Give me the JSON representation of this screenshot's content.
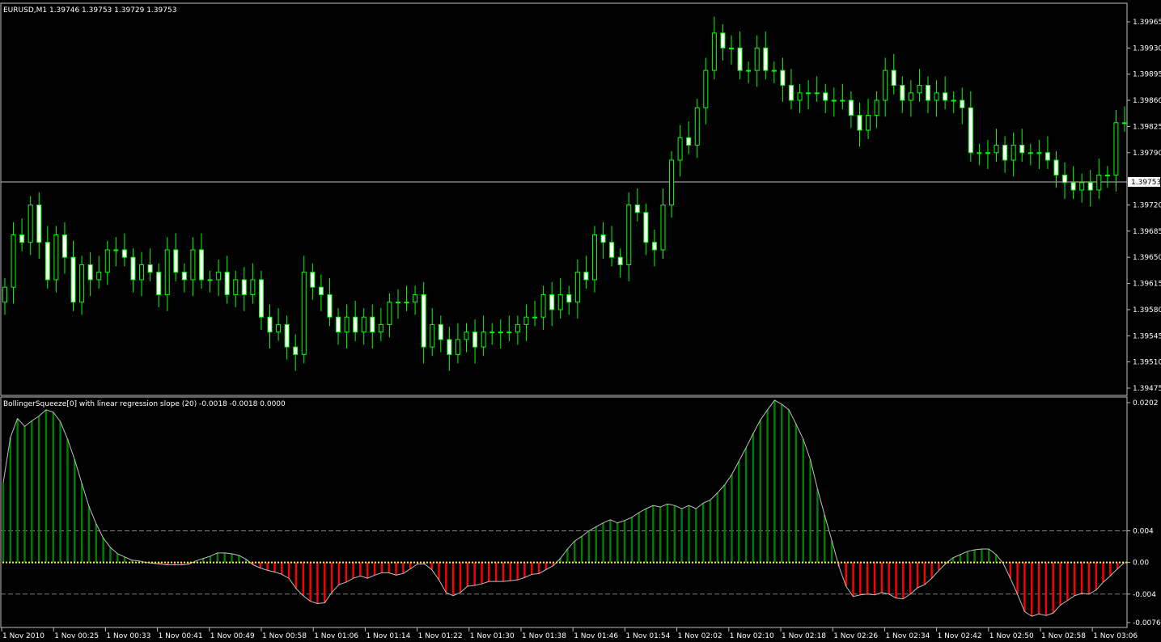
{
  "main_chart": {
    "header": "EURUSD,M1  1.39746 1.39753 1.39729 1.39753",
    "symbol": "EURUSD",
    "timeframe": "M1",
    "price_labels": [
      "1.39965",
      "1.39930",
      "1.39895",
      "1.39860",
      "1.39825",
      "1.39790",
      "1.39720",
      "1.39685",
      "1.39650",
      "1.39615",
      "1.39580",
      "1.39545",
      "1.39510",
      "1.39475"
    ],
    "current_price_label": "1.39753"
  },
  "indicator": {
    "header": "BollingerSqueeze[0] with linear regression slope (20) -0.0018 -0.0018 0.0000",
    "scale_labels": [
      "0.0202",
      "0.004",
      "0.00",
      "-0.004",
      "-0.0076"
    ]
  },
  "time_axis": {
    "labels": [
      "1 Nov 2010",
      "1 Nov 00:25",
      "1 Nov 00:33",
      "1 Nov 00:41",
      "1 Nov 00:49",
      "1 Nov 00:58",
      "1 Nov 01:06",
      "1 Nov 01:14",
      "1 Nov 01:22",
      "1 Nov 01:30",
      "1 Nov 01:38",
      "1 Nov 01:46",
      "1 Nov 01:54",
      "1 Nov 02:02",
      "1 Nov 02:10",
      "1 Nov 02:18",
      "1 Nov 02:26",
      "1 Nov 02:34",
      "1 Nov 02:42",
      "1 Nov 02:50",
      "1 Nov 02:58",
      "1 Nov 03:06"
    ]
  },
  "colors": {
    "background": "#000000",
    "border": "#c0c0c0",
    "candle": "#00ff00",
    "bull_fill": "#000000",
    "bear_fill": "#ffffff",
    "hist_positive": "#008000",
    "hist_negative": "#ff0000",
    "zero_dots": "#ffff00",
    "slope_line": "#c0c0c0",
    "level_lines": "#808080"
  },
  "chart_data": [
    {
      "type": "candlestick",
      "title": "EURUSD,M1",
      "ylim": [
        1.3947,
        1.3998
      ],
      "last_price": 1.39753,
      "closes": [
        1.3961,
        1.3968,
        1.3967,
        1.3972,
        1.3967,
        1.3962,
        1.3968,
        1.3965,
        1.3959,
        1.3964,
        1.3962,
        1.3963,
        1.3966,
        1.3966,
        1.3965,
        1.3962,
        1.3964,
        1.3963,
        1.396,
        1.3966,
        1.3963,
        1.3962,
        1.3966,
        1.3962,
        1.3962,
        1.3963,
        1.396,
        1.3962,
        1.396,
        1.3962,
        1.3957,
        1.3955,
        1.3956,
        1.3953,
        1.3952,
        1.3963,
        1.3961,
        1.396,
        1.3957,
        1.3955,
        1.3957,
        1.3955,
        1.3957,
        1.3955,
        1.3956,
        1.3959,
        1.3959,
        1.3959,
        1.396,
        1.3953,
        1.3956,
        1.3954,
        1.3952,
        1.3954,
        1.3955,
        1.3953,
        1.3955,
        1.3955,
        1.3955,
        1.3955,
        1.3956,
        1.3957,
        1.3957,
        1.396,
        1.3958,
        1.396,
        1.3959,
        1.3963,
        1.3962,
        1.3968,
        1.3967,
        1.3965,
        1.3964,
        1.3972,
        1.3971,
        1.3967,
        1.3966,
        1.3972,
        1.3978,
        1.3981,
        1.398,
        1.3985,
        1.399,
        1.3995,
        1.3993,
        1.3993,
        1.399,
        1.399,
        1.3993,
        1.399,
        1.399,
        1.3988,
        1.3986,
        1.3987,
        1.3987,
        1.3987,
        1.3986,
        1.3986,
        1.3986,
        1.3984,
        1.3982,
        1.3984,
        1.3986,
        1.399,
        1.3988,
        1.3986,
        1.3987,
        1.3988,
        1.3986,
        1.3987,
        1.3986,
        1.3986,
        1.3985,
        1.3979,
        1.3979,
        1.3979,
        1.398,
        1.3978,
        1.398,
        1.3979,
        1.3979,
        1.3979,
        1.3978,
        1.3976,
        1.3975,
        1.3974,
        1.3975,
        1.3974,
        1.3976,
        1.3976,
        1.3983,
        1.3983
      ]
    },
    {
      "type": "bar",
      "title": "BollingerSqueeze[0] with linear regression slope (20)",
      "ylim": [
        -0.0076,
        0.0202
      ],
      "levels": [
        0.004,
        -0.004
      ],
      "values": [
        0.0101,
        0.0158,
        0.0182,
        0.0172,
        0.0179,
        0.0185,
        0.0193,
        0.019,
        0.0178,
        0.0156,
        0.013,
        0.01,
        0.0071,
        0.0049,
        0.0031,
        0.0019,
        0.0011,
        0.0007,
        0.0003,
        0.0002,
        0.0,
        -0.0001,
        -0.0002,
        -0.0003,
        -0.0003,
        -0.0003,
        -0.0002,
        0.0002,
        0.0005,
        0.0008,
        0.0012,
        0.0012,
        0.0011,
        0.0009,
        0.0004,
        -0.0003,
        -0.0007,
        -0.001,
        -0.0012,
        -0.0015,
        -0.002,
        -0.0033,
        -0.0042,
        -0.0049,
        -0.0052,
        -0.0051,
        -0.0038,
        -0.0028,
        -0.0025,
        -0.002,
        -0.0017,
        -0.002,
        -0.0016,
        -0.0013,
        -0.0013,
        -0.0016,
        -0.0014,
        -0.0008,
        -0.0002,
        -0.0002,
        -0.0009,
        -0.0022,
        -0.0038,
        -0.0042,
        -0.0038,
        -0.003,
        -0.0029,
        -0.0027,
        -0.0024,
        -0.0024,
        -0.0024,
        -0.0023,
        -0.0022,
        -0.0019,
        -0.0015,
        -0.0014,
        -0.0009,
        -0.0004,
        0.0005,
        0.0017,
        0.0027,
        0.0033,
        0.004,
        0.0045,
        0.005,
        0.0054,
        0.005,
        0.0053,
        0.0057,
        0.0063,
        0.0068,
        0.0072,
        0.007,
        0.0074,
        0.0072,
        0.0068,
        0.0072,
        0.0068,
        0.0075,
        0.0079,
        0.0088,
        0.0098,
        0.0111,
        0.0128,
        0.0145,
        0.0163,
        0.018,
        0.0193,
        0.0205,
        0.02,
        0.0193,
        0.0175,
        0.0156,
        0.013,
        0.0093,
        0.006,
        0.0028,
        -0.0005,
        -0.003,
        -0.0043,
        -0.0041,
        -0.004,
        -0.0041,
        -0.0038,
        -0.004,
        -0.0045,
        -0.0046,
        -0.004,
        -0.0032,
        -0.0028,
        -0.002,
        -0.001,
        -0.0001,
        0.0006,
        0.001,
        0.0014,
        0.0016,
        0.0017,
        0.0017,
        0.001,
        -0.0001,
        -0.002,
        -0.004,
        -0.0062,
        -0.0068,
        -0.0065,
        -0.0067,
        -0.0064,
        -0.0054,
        -0.0048,
        -0.0042,
        -0.0039,
        -0.004,
        -0.0035,
        -0.0025,
        -0.0017,
        -0.0008,
        0.0
      ]
    }
  ]
}
